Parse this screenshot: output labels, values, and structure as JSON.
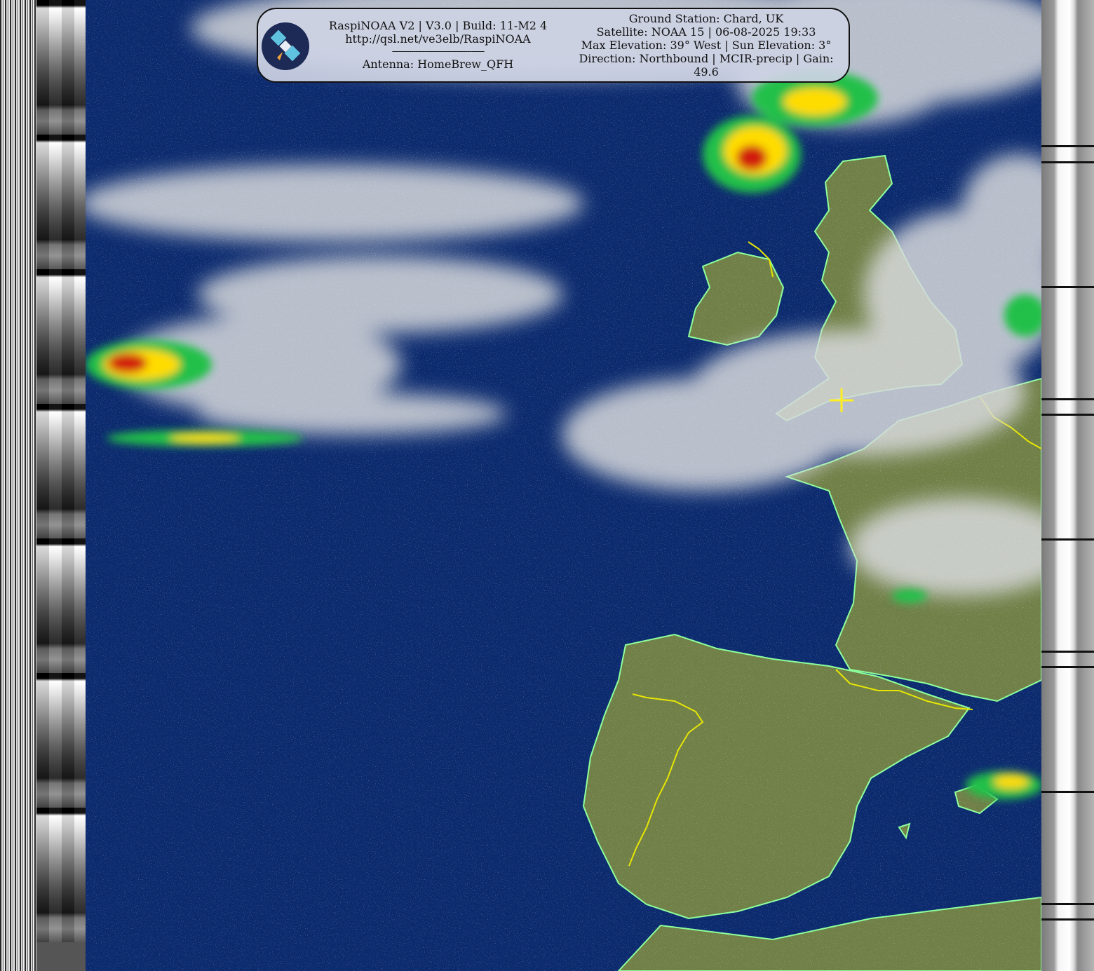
{
  "header": {
    "software": "RaspiNOAA V2 | V3.0 | Build: 11-M2 4",
    "url": "http://qsl.net/ve3elb/RaspiNOAA",
    "separator": "-------------------------------------------",
    "antenna": "Antenna: HomeBrew_QFH",
    "ground_station": "Ground Station: Chard, UK",
    "satellite": "Satellite: NOAA 15 | 06-08-2025 19:33",
    "elevation": "Max Elevation: 39° West | Sun Elevation: 3°",
    "direction": "Direction: Northbound | MCIR-precip | Gain: 49.6"
  },
  "icons": {
    "logo": "satellite-icon",
    "station_marker": "crosshair-icon"
  },
  "colors": {
    "ocean": "#0b2a6e",
    "land": "#6f7f46",
    "cloud": "#d7d9dc",
    "coastline": "#8cff9a",
    "border": "#e6e600",
    "precip_red": "#d11a0c",
    "precip_yellow": "#ffdc00",
    "precip_green": "#21c04a",
    "marker": "#ffee22"
  }
}
